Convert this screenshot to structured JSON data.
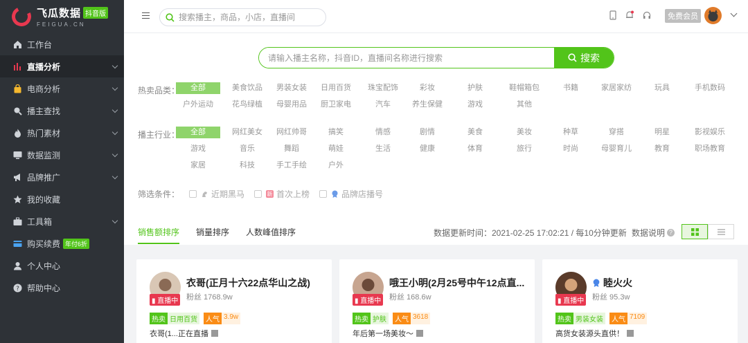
{
  "logo": {
    "title": "飞瓜数据",
    "badge": "抖音版",
    "subtitle": "FEIGUA.CN"
  },
  "sidebar": {
    "items": [
      {
        "label": "工作台",
        "icon": "home-icon"
      },
      {
        "label": "直播分析",
        "icon": "bar-chart-icon",
        "active": true
      },
      {
        "label": "电商分析",
        "icon": "shopping-bag-icon"
      },
      {
        "label": "播主查找",
        "icon": "search-icon"
      },
      {
        "label": "热门素材",
        "icon": "fire-icon"
      },
      {
        "label": "数据监测",
        "icon": "monitor-icon"
      },
      {
        "label": "品牌推广",
        "icon": "megaphone-icon"
      },
      {
        "label": "我的收藏",
        "icon": "star-icon"
      },
      {
        "label": "工具箱",
        "icon": "toolbox-icon"
      },
      {
        "label": "购买续费",
        "icon": "card-icon",
        "badge": "年付6折"
      },
      {
        "label": "个人中心",
        "icon": "user-icon"
      },
      {
        "label": "帮助中心",
        "icon": "help-icon"
      }
    ]
  },
  "topbar": {
    "search_placeholder": "搜索播主，商品，小店，直播间",
    "member_label": "免费会员"
  },
  "main_search": {
    "placeholder": "请输入播主名称，抖音ID，直播间名称进行搜索",
    "button": "搜索"
  },
  "filters": {
    "category_label": "热卖品类：",
    "categories": [
      "全部",
      "美食饮品",
      "男装女装",
      "日用百货",
      "珠宝配饰",
      "彩妆",
      "护肤",
      "鞋帽箱包",
      "书籍",
      "家居家纺",
      "玩具",
      "手机数码",
      "户外运动",
      "花鸟绿植",
      "母婴用品",
      "厨卫家电",
      "汽车",
      "养生保健",
      "游戏",
      "其他"
    ],
    "industry_label": "播主行业：",
    "industries": [
      "全部",
      "网红美女",
      "网红帅哥",
      "搞笑",
      "情感",
      "剧情",
      "美食",
      "美妆",
      "种草",
      "穿搭",
      "明星",
      "影视娱乐",
      "游戏",
      "音乐",
      "舞蹈",
      "萌娃",
      "生活",
      "健康",
      "体育",
      "旅行",
      "时尚",
      "母婴育儿",
      "教育",
      "职场教育",
      "家居",
      "科技",
      "手工手绘",
      "户外"
    ],
    "condition_label": "筛选条件：",
    "conditions": [
      "近期黑马",
      "首次上榜",
      "品牌店播号"
    ]
  },
  "tabs": [
    "销售额排序",
    "销量排序",
    "人数峰值排序"
  ],
  "update_info": "数据更新时间：2021-02-25 17:02:21 / 每10分钟更新",
  "data_explain": "数据说明",
  "cards": [
    {
      "name": "衣哥(正月十六22点华山之战)",
      "fans": "粉丝 1768.9w",
      "live": "直播中",
      "hot": "热卖",
      "category": "日用百货",
      "pop": "人气",
      "pop_value": "3.9w",
      "desc": "衣哥(1...正在直播"
    },
    {
      "name": "哦王小明(2月25号中午12点直...",
      "fans": "粉丝 168.6w",
      "live": "直播中",
      "hot": "热卖",
      "category": "护肤",
      "pop": "人气",
      "pop_value": "3618",
      "desc": "年后第一场美妆～"
    },
    {
      "name": "睦火火",
      "fans": "粉丝 95.3w",
      "live": "直播中",
      "hot": "热卖",
      "category": "男装女装",
      "pop": "人气",
      "pop_value": "7109",
      "desc": "高货女装源头直供！"
    }
  ]
}
